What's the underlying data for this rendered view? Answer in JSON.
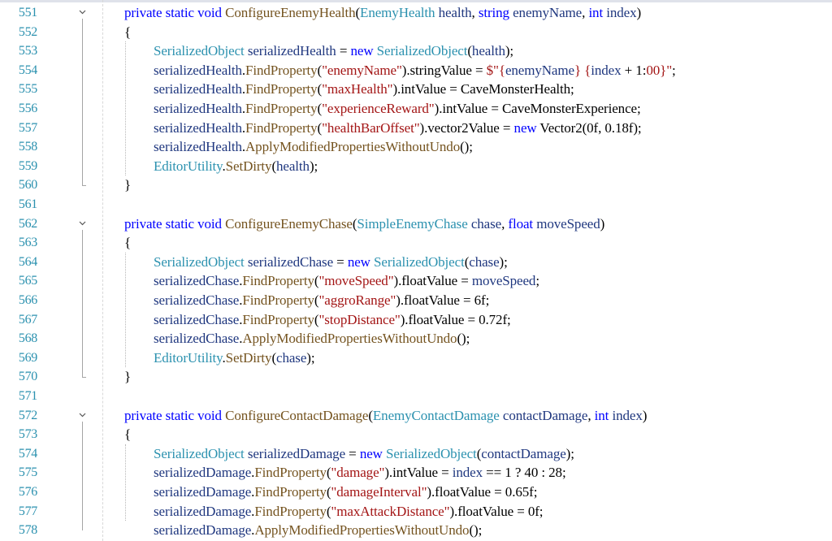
{
  "editor": {
    "lines": [
      {
        "n": "551",
        "fold": true,
        "tokens": [
          [
            "kw",
            "private "
          ],
          [
            "kw",
            "static "
          ],
          [
            "kw",
            "void "
          ],
          [
            "fn",
            "ConfigureEnemyHealth"
          ],
          [
            "p",
            "("
          ],
          [
            "tp",
            "EnemyHealth"
          ],
          [
            "p",
            " "
          ],
          [
            "var",
            "health"
          ],
          [
            "p",
            ", "
          ],
          [
            "kw",
            "string "
          ],
          [
            "var",
            "enemyName"
          ],
          [
            "p",
            ", "
          ],
          [
            "kw",
            "int "
          ],
          [
            "var",
            "index"
          ],
          [
            "p",
            ")"
          ]
        ],
        "indent": 1
      },
      {
        "n": "552",
        "tokens": [
          [
            "p",
            "{"
          ]
        ],
        "indent": 1
      },
      {
        "n": "553",
        "tokens": [
          [
            "tp",
            "SerializedObject"
          ],
          [
            "p",
            " "
          ],
          [
            "var",
            "serializedHealth"
          ],
          [
            "p",
            " = "
          ],
          [
            "kw",
            "new "
          ],
          [
            "tp",
            "SerializedObject"
          ],
          [
            "p",
            "("
          ],
          [
            "var",
            "health"
          ],
          [
            "p",
            ");"
          ]
        ],
        "indent": 2
      },
      {
        "n": "554",
        "tokens": [
          [
            "var",
            "serializedHealth"
          ],
          [
            "p",
            "."
          ],
          [
            "fn",
            "FindProperty"
          ],
          [
            "p",
            "("
          ],
          [
            "str",
            "\"enemyName\""
          ],
          [
            "p",
            ")."
          ],
          [
            "p",
            "stringValue = "
          ],
          [
            "str",
            "$\"{"
          ],
          [
            "var",
            "enemyName"
          ],
          [
            "str",
            "} {"
          ],
          [
            "var",
            "index"
          ],
          [
            "p",
            " + 1:"
          ],
          [
            "str",
            "00}\""
          ],
          [
            "p",
            ";"
          ]
        ],
        "indent": 2
      },
      {
        "n": "555",
        "tokens": [
          [
            "var",
            "serializedHealth"
          ],
          [
            "p",
            "."
          ],
          [
            "fn",
            "FindProperty"
          ],
          [
            "p",
            "("
          ],
          [
            "str",
            "\"maxHealth\""
          ],
          [
            "p",
            ")."
          ],
          [
            "p",
            "intValue = "
          ],
          [
            "p",
            "CaveMonsterHealth;"
          ]
        ],
        "indent": 2
      },
      {
        "n": "556",
        "tokens": [
          [
            "var",
            "serializedHealth"
          ],
          [
            "p",
            "."
          ],
          [
            "fn",
            "FindProperty"
          ],
          [
            "p",
            "("
          ],
          [
            "str",
            "\"experienceReward\""
          ],
          [
            "p",
            ")."
          ],
          [
            "p",
            "intValue = "
          ],
          [
            "p",
            "CaveMonsterExperience;"
          ]
        ],
        "indent": 2
      },
      {
        "n": "557",
        "tokens": [
          [
            "var",
            "serializedHealth"
          ],
          [
            "p",
            "."
          ],
          [
            "fn",
            "FindProperty"
          ],
          [
            "p",
            "("
          ],
          [
            "str",
            "\"healthBarOffset\""
          ],
          [
            "p",
            ")."
          ],
          [
            "p",
            "vector2Value = "
          ],
          [
            "kw",
            "new "
          ],
          [
            "p",
            "Vector2(0f, 0.18f);"
          ]
        ],
        "indent": 2
      },
      {
        "n": "558",
        "tokens": [
          [
            "var",
            "serializedHealth"
          ],
          [
            "p",
            "."
          ],
          [
            "fn",
            "ApplyModifiedPropertiesWithoutUndo"
          ],
          [
            "p",
            "();"
          ]
        ],
        "indent": 2
      },
      {
        "n": "559",
        "tokens": [
          [
            "tp",
            "EditorUtility"
          ],
          [
            "p",
            "."
          ],
          [
            "fn",
            "SetDirty"
          ],
          [
            "p",
            "("
          ],
          [
            "var",
            "health"
          ],
          [
            "p",
            ");"
          ]
        ],
        "indent": 2
      },
      {
        "n": "560",
        "tokens": [
          [
            "p",
            "}"
          ]
        ],
        "indent": 1
      },
      {
        "n": "561",
        "tokens": [],
        "indent": 1
      },
      {
        "n": "562",
        "fold": true,
        "tokens": [
          [
            "kw",
            "private "
          ],
          [
            "kw",
            "static "
          ],
          [
            "kw",
            "void "
          ],
          [
            "fn",
            "ConfigureEnemyChase"
          ],
          [
            "p",
            "("
          ],
          [
            "tp",
            "SimpleEnemyChase"
          ],
          [
            "p",
            " "
          ],
          [
            "var",
            "chase"
          ],
          [
            "p",
            ", "
          ],
          [
            "kw",
            "float "
          ],
          [
            "var",
            "moveSpeed"
          ],
          [
            "p",
            ")"
          ]
        ],
        "indent": 1
      },
      {
        "n": "563",
        "tokens": [
          [
            "p",
            "{"
          ]
        ],
        "indent": 1
      },
      {
        "n": "564",
        "tokens": [
          [
            "tp",
            "SerializedObject"
          ],
          [
            "p",
            " "
          ],
          [
            "var",
            "serializedChase"
          ],
          [
            "p",
            " = "
          ],
          [
            "kw",
            "new "
          ],
          [
            "tp",
            "SerializedObject"
          ],
          [
            "p",
            "("
          ],
          [
            "var",
            "chase"
          ],
          [
            "p",
            ");"
          ]
        ],
        "indent": 2
      },
      {
        "n": "565",
        "tokens": [
          [
            "var",
            "serializedChase"
          ],
          [
            "p",
            "."
          ],
          [
            "fn",
            "FindProperty"
          ],
          [
            "p",
            "("
          ],
          [
            "str",
            "\"moveSpeed\""
          ],
          [
            "p",
            ")."
          ],
          [
            "p",
            "floatValue = "
          ],
          [
            "var",
            "moveSpeed"
          ],
          [
            "p",
            ";"
          ]
        ],
        "indent": 2
      },
      {
        "n": "566",
        "tokens": [
          [
            "var",
            "serializedChase"
          ],
          [
            "p",
            "."
          ],
          [
            "fn",
            "FindProperty"
          ],
          [
            "p",
            "("
          ],
          [
            "str",
            "\"aggroRange\""
          ],
          [
            "p",
            ")."
          ],
          [
            "p",
            "floatValue = 6f;"
          ]
        ],
        "indent": 2
      },
      {
        "n": "567",
        "tokens": [
          [
            "var",
            "serializedChase"
          ],
          [
            "p",
            "."
          ],
          [
            "fn",
            "FindProperty"
          ],
          [
            "p",
            "("
          ],
          [
            "str",
            "\"stopDistance\""
          ],
          [
            "p",
            ")."
          ],
          [
            "p",
            "floatValue = 0.72f;"
          ]
        ],
        "indent": 2
      },
      {
        "n": "568",
        "tokens": [
          [
            "var",
            "serializedChase"
          ],
          [
            "p",
            "."
          ],
          [
            "fn",
            "ApplyModifiedPropertiesWithoutUndo"
          ],
          [
            "p",
            "();"
          ]
        ],
        "indent": 2
      },
      {
        "n": "569",
        "tokens": [
          [
            "tp",
            "EditorUtility"
          ],
          [
            "p",
            "."
          ],
          [
            "fn",
            "SetDirty"
          ],
          [
            "p",
            "("
          ],
          [
            "var",
            "chase"
          ],
          [
            "p",
            ");"
          ]
        ],
        "indent": 2
      },
      {
        "n": "570",
        "tokens": [
          [
            "p",
            "}"
          ]
        ],
        "indent": 1
      },
      {
        "n": "571",
        "tokens": [],
        "indent": 1
      },
      {
        "n": "572",
        "fold": true,
        "tokens": [
          [
            "kw",
            "private "
          ],
          [
            "kw",
            "static "
          ],
          [
            "kw",
            "void "
          ],
          [
            "fn",
            "ConfigureContactDamage"
          ],
          [
            "p",
            "("
          ],
          [
            "tp",
            "EnemyContactDamage"
          ],
          [
            "p",
            " "
          ],
          [
            "var",
            "contactDamage"
          ],
          [
            "p",
            ", "
          ],
          [
            "kw",
            "int "
          ],
          [
            "var",
            "index"
          ],
          [
            "p",
            ")"
          ]
        ],
        "indent": 1
      },
      {
        "n": "573",
        "tokens": [
          [
            "p",
            "{"
          ]
        ],
        "indent": 1
      },
      {
        "n": "574",
        "tokens": [
          [
            "tp",
            "SerializedObject"
          ],
          [
            "p",
            " "
          ],
          [
            "var",
            "serializedDamage"
          ],
          [
            "p",
            " = "
          ],
          [
            "kw",
            "new "
          ],
          [
            "tp",
            "SerializedObject"
          ],
          [
            "p",
            "("
          ],
          [
            "var",
            "contactDamage"
          ],
          [
            "p",
            ");"
          ]
        ],
        "indent": 2
      },
      {
        "n": "575",
        "tokens": [
          [
            "var",
            "serializedDamage"
          ],
          [
            "p",
            "."
          ],
          [
            "fn",
            "FindProperty"
          ],
          [
            "p",
            "("
          ],
          [
            "str",
            "\"damage\""
          ],
          [
            "p",
            ")."
          ],
          [
            "p",
            "intValue = "
          ],
          [
            "var",
            "index"
          ],
          [
            "p",
            " == 1 ? 40 : 28;"
          ]
        ],
        "indent": 2
      },
      {
        "n": "576",
        "tokens": [
          [
            "var",
            "serializedDamage"
          ],
          [
            "p",
            "."
          ],
          [
            "fn",
            "FindProperty"
          ],
          [
            "p",
            "("
          ],
          [
            "str",
            "\"damageInterval\""
          ],
          [
            "p",
            ")."
          ],
          [
            "p",
            "floatValue = 0.65f;"
          ]
        ],
        "indent": 2
      },
      {
        "n": "577",
        "tokens": [
          [
            "var",
            "serializedDamage"
          ],
          [
            "p",
            "."
          ],
          [
            "fn",
            "FindProperty"
          ],
          [
            "p",
            "("
          ],
          [
            "str",
            "\"maxAttackDistance\""
          ],
          [
            "p",
            ")."
          ],
          [
            "p",
            "floatValue = 0f;"
          ]
        ],
        "indent": 2
      },
      {
        "n": "578",
        "tokens": [
          [
            "var",
            "serializedDamage"
          ],
          [
            "p",
            "."
          ],
          [
            "fn",
            "ApplyModifiedPropertiesWithoutUndo"
          ],
          [
            "p",
            "();"
          ]
        ],
        "indent": 2
      }
    ]
  },
  "colors": {
    "keyword": "#0000ff",
    "method": "#74531f",
    "type": "#2b91af",
    "variable": "#1f377f",
    "string": "#a31515",
    "line_number": "#2b91af"
  },
  "icons": {
    "fold": "chevron-down-icon"
  }
}
